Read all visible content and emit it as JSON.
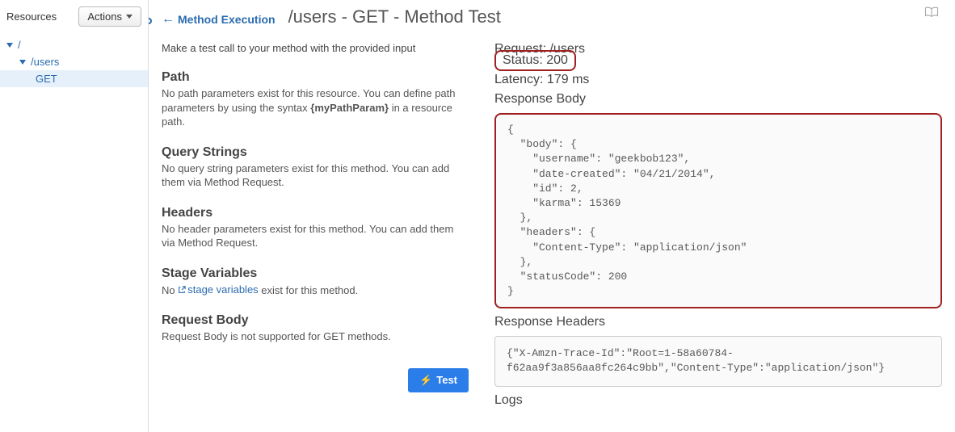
{
  "sidebar": {
    "title": "Resources",
    "actions_label": "Actions",
    "tree": {
      "root": "/",
      "child": "/users",
      "leaf": "GET"
    }
  },
  "header": {
    "back_label": "Method Execution",
    "title": "/users - GET - Method Test"
  },
  "left": {
    "intro": "Make a test call to your method with the provided input",
    "path": {
      "title": "Path",
      "text_prefix": "No path parameters exist for this resource. You can define path parameters by using the syntax ",
      "param": "{myPathParam}",
      "text_suffix": " in a resource path."
    },
    "query": {
      "title": "Query Strings",
      "text": "No query string parameters exist for this method. You can add them via Method Request."
    },
    "headers": {
      "title": "Headers",
      "text": "No header parameters exist for this method. You can add them via Method Request."
    },
    "stage": {
      "title": "Stage Variables",
      "prefix": "No ",
      "link": "stage variables",
      "suffix": " exist for this method."
    },
    "body": {
      "title": "Request Body",
      "text": "Request Body is not supported for GET methods."
    },
    "test_label": "Test"
  },
  "right": {
    "request": "Request: /users",
    "status": "Status: 200",
    "latency": "Latency: 179 ms",
    "response_body_title": "Response Body",
    "response_body": "{\n  \"body\": {\n    \"username\": \"geekbob123\",\n    \"date-created\": \"04/21/2014\",\n    \"id\": 2,\n    \"karma\": 15369\n  },\n  \"headers\": {\n    \"Content-Type\": \"application/json\"\n  },\n  \"statusCode\": 200\n}",
    "response_headers_title": "Response Headers",
    "response_headers": "{\"X-Amzn-Trace-Id\":\"Root=1-58a60784-f62aa9f3a856aa8fc264c9bb\",\"Content-Type\":\"application/json\"}",
    "logs_title": "Logs"
  }
}
